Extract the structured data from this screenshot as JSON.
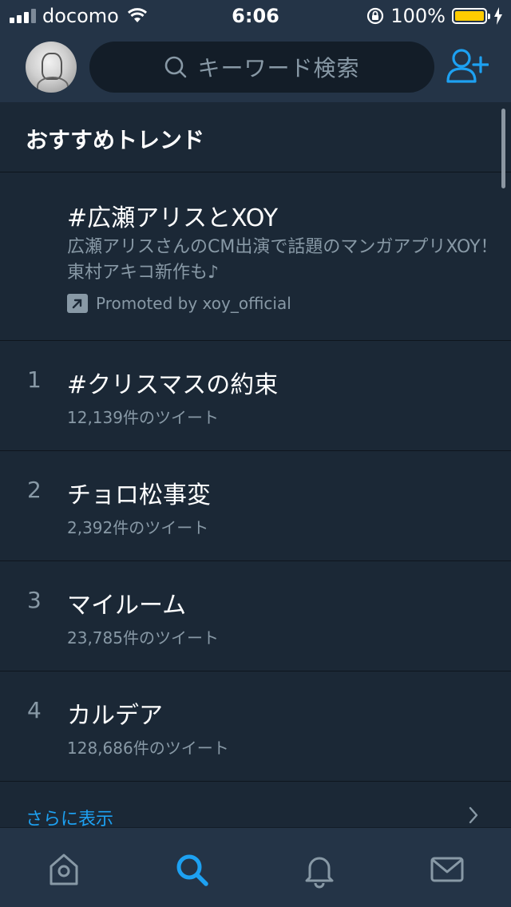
{
  "status_bar": {
    "carrier": "docomo",
    "time": "6:06",
    "battery_percent": "100%",
    "battery_level": 1.0,
    "signal_bars_filled": 3,
    "signal_bars_total": 4
  },
  "header": {
    "search_placeholder": "キーワード検索",
    "accent_color": "#1da1f2"
  },
  "section": {
    "title": "おすすめトレンド"
  },
  "promoted": {
    "title": "#広瀬アリスとXOY",
    "description": "広瀬アリスさんのCM出演で話題のマンガアプリXOY！東村アキコ新作も♪",
    "promoted_by": "Promoted by xoy_official"
  },
  "trends": [
    {
      "rank": "1",
      "name": "#クリスマスの約束",
      "count": "12,139件のツイート"
    },
    {
      "rank": "2",
      "name": "チョロ松事変",
      "count": "2,392件のツイート"
    },
    {
      "rank": "3",
      "name": "マイルーム",
      "count": "23,785件のツイート"
    },
    {
      "rank": "4",
      "name": "カルデア",
      "count": "128,686件のツイート"
    }
  ],
  "show_more": {
    "label": "さらに表示"
  },
  "tabbar": {
    "icons": [
      "home-icon",
      "search-icon",
      "notifications-icon",
      "messages-icon"
    ],
    "active": "search-icon"
  }
}
